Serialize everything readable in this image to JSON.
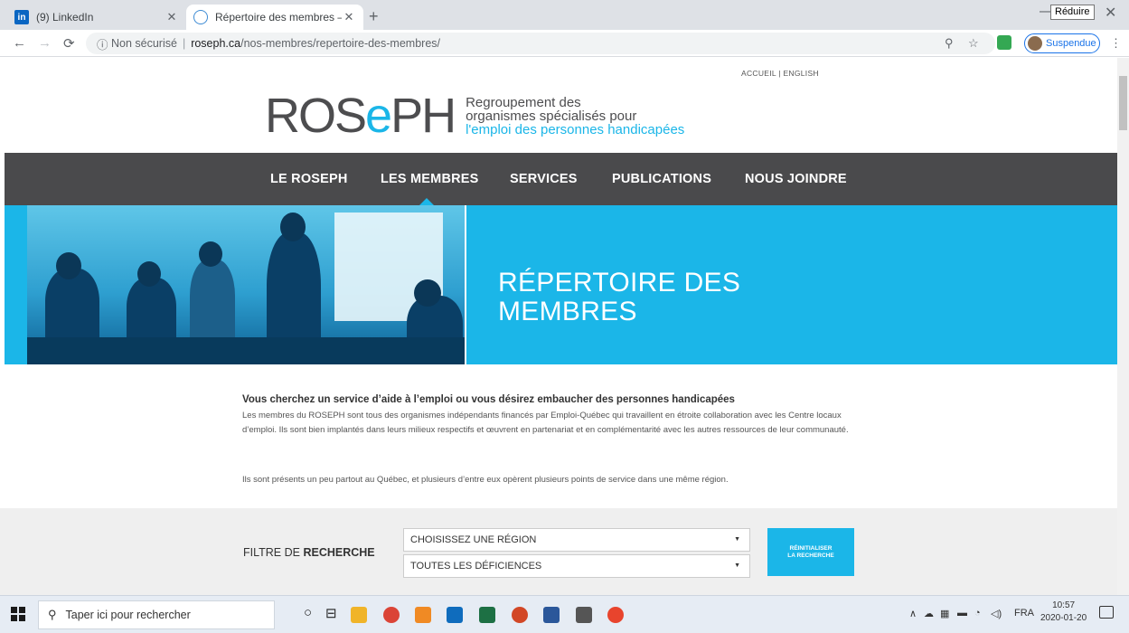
{
  "browser": {
    "tabs": [
      {
        "title": "(9) LinkedIn",
        "favicon": "linkedin-icon",
        "active": false
      },
      {
        "title": "Répertoire des membres – ROSEPH",
        "favicon": "globe-icon",
        "active": true
      }
    ],
    "tooltip": "Réduire",
    "security_label": "Non sécurisé",
    "url_domain": "roseph.ca",
    "url_path": "/nos-membres/repertoire-des-membres/",
    "profile_label": "Suspendue"
  },
  "page": {
    "toplinks": "ACCUEIL | ENGLISH",
    "logo": {
      "word_a": "ROS",
      "word_e": "e",
      "word_b": "PH",
      "tag_line1": "Regroupement des",
      "tag_line2": "organismes spécialisés pour",
      "tag_line3": "l'emploi des personnes handicapées"
    },
    "nav": [
      {
        "label": "LE ROSEPH"
      },
      {
        "label": "LES MEMBRES",
        "active": true
      },
      {
        "label": "SERVICES"
      },
      {
        "label": "PUBLICATIONS"
      },
      {
        "label": "NOUS JOINDRE"
      }
    ],
    "hero_line1": "RÉPERTOIRE DES",
    "hero_line2": "MEMBRES",
    "intro_title": "Vous cherchez un service d’aide à l’emploi ou vous désirez embaucher des personnes handicapées",
    "intro_p1": "Les membres du ROSEPH sont tous des organismes indépendants financés par Emploi-Québec qui travaillent en étroite collaboration avec les Centre locaux d’emploi. Ils sont bien implantés dans leurs milieux respectifs et œuvrent en partenariat et en complémentarité avec les autres ressources de leur communauté.",
    "intro_p2": "Ils sont présents un peu partout au Québec, et plusieurs d’entre eux opèrent plusieurs points de service dans une même région.",
    "filter": {
      "label_prefix": "FILTRE DE ",
      "label_bold": "RECHERCHE",
      "region_select": "CHOISISSEZ UNE RÉGION",
      "deficiency_select": "TOUTES LES DÉFICIENCES",
      "reset_line1": "RÉINITIALISER",
      "reset_line2": "LA RECHERCHE"
    },
    "accent_color": "#1bb6e8",
    "nav_bg_color": "#4a4a4c"
  },
  "taskbar": {
    "search_placeholder": "Taper ici pour rechercher",
    "lang": "FRA",
    "time": "10:57",
    "date": "2020-01-20"
  }
}
